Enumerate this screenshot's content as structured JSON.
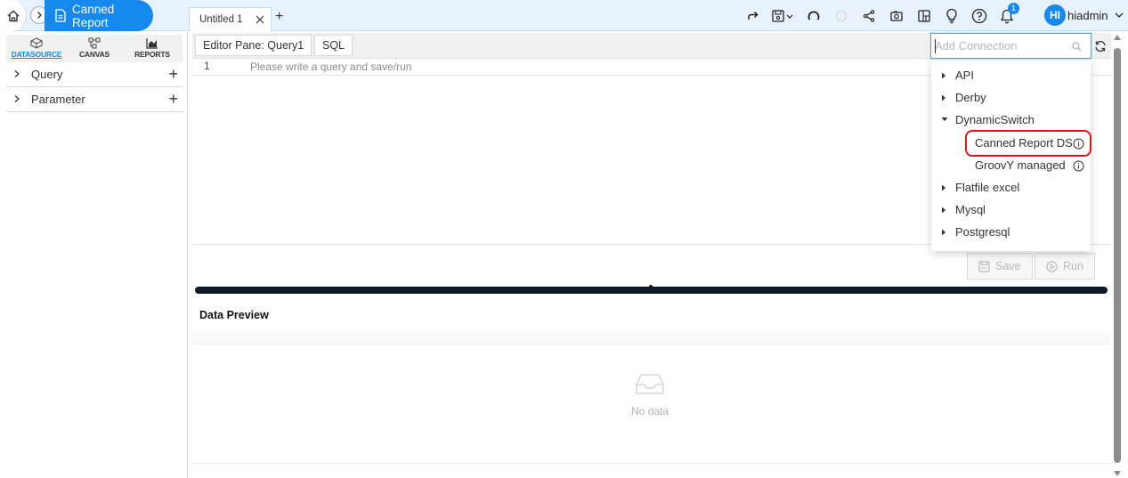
{
  "header": {
    "breadcrumb_label": "Canned Report",
    "tab_label": "Untitled 1",
    "tab_add": "+",
    "user": {
      "initials": "HI",
      "name": "hiadmin"
    },
    "notification_count": "1"
  },
  "sidebar": {
    "tabs": [
      {
        "label": "DATASOURCE",
        "active": true
      },
      {
        "label": "CANVAS",
        "active": false
      },
      {
        "label": "REPORTS",
        "active": false
      }
    ],
    "sections": [
      {
        "label": "Query",
        "add": "+"
      },
      {
        "label": "Parameter",
        "add": "+"
      }
    ]
  },
  "editor": {
    "pane_label": "Editor Pane: Query1",
    "mode_label": "SQL",
    "line_number": "1",
    "placeholder": "Please write a query and save/run",
    "save_label": "Save",
    "run_label": "Run"
  },
  "connections": {
    "search_placeholder": "Add Connection",
    "items": [
      {
        "label": "API",
        "expanded": false
      },
      {
        "label": "Derby",
        "expanded": false
      },
      {
        "label": "DynamicSwitch",
        "expanded": true,
        "children": [
          {
            "label": "Canned Report DS",
            "highlighted": true
          },
          {
            "label": "GroovY managed",
            "highlighted": false
          }
        ]
      },
      {
        "label": "Flatfile excel",
        "expanded": false
      },
      {
        "label": "Mysql",
        "expanded": false
      },
      {
        "label": "Postgresql",
        "expanded": false
      }
    ]
  },
  "preview": {
    "title": "Data Preview",
    "empty_text": "No data"
  },
  "colors": {
    "accent": "#1589ee",
    "header_bg": "#e7f3fc",
    "highlight_ring": "#e0161d",
    "splitter": "#0d1a26"
  },
  "icons": {
    "home": "home-icon",
    "report": "report-doc-icon",
    "redo": "redo-arrow-icon",
    "save_menu": "save-menu-icon",
    "undo": "undo-circle-icon",
    "loading": "loading-icon",
    "share": "share-icon",
    "snapshot": "camera-icon",
    "layout": "layout-icon",
    "hint": "lightbulb-icon",
    "help": "help-icon",
    "notifications": "bell-icon",
    "search": "search-icon",
    "refresh": "refresh-icon",
    "info": "info-icon"
  }
}
